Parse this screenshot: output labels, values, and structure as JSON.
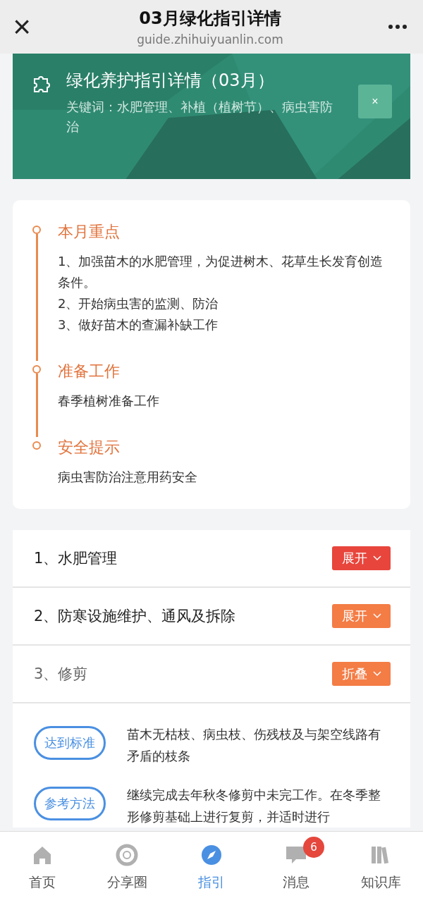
{
  "nav": {
    "title": "03月绿化指引详情",
    "url": "guide.zhihuiyuanlin.com",
    "close": "×"
  },
  "banner": {
    "title": "绿化养护指引详情（03月）",
    "keywords": "关键词：水肥管理、补植（植树节）、病虫害防治",
    "close": "×"
  },
  "timeline": [
    {
      "heading": "本月重点",
      "lines": [
        "1、加强苗木的水肥管理，为促进树木、花草生长发育创造条件。",
        "2、开始病虫害的监测、防治",
        "3、做好苗木的查漏补缺工作"
      ]
    },
    {
      "heading": "准备工作",
      "lines": [
        "春季植树准备工作"
      ]
    },
    {
      "heading": "安全提示",
      "lines": [
        "病虫害防治注意用药安全"
      ]
    }
  ],
  "sections": [
    {
      "title": "1、水肥管理",
      "button": "展开",
      "expanded": false,
      "color": "#e8453c"
    },
    {
      "title": "2、防寒设施维护、通风及拆除",
      "button": "展开",
      "expanded": false,
      "color": "#f47c45"
    },
    {
      "title": "3、修剪",
      "button": "折叠",
      "expanded": true,
      "color": "#f47c45",
      "details": [
        {
          "tag": "达到标准",
          "text": "苗木无枯枝、病虫枝、伤残枝及与架空线路有矛盾的枝条"
        },
        {
          "tag": "参考方法",
          "text": "继续完成去年秋冬修剪中未完工作。在冬季整形修剪基础上进行复剪，并适时进行"
        }
      ]
    }
  ],
  "tabbar": [
    {
      "kind": "home",
      "label": "首页",
      "selected": false
    },
    {
      "kind": "share",
      "label": "分享圈",
      "selected": false
    },
    {
      "kind": "guide",
      "label": "指引",
      "selected": true
    },
    {
      "kind": "message",
      "label": "消息",
      "selected": false,
      "badge": "6"
    },
    {
      "kind": "library",
      "label": "知识库",
      "selected": false
    }
  ]
}
